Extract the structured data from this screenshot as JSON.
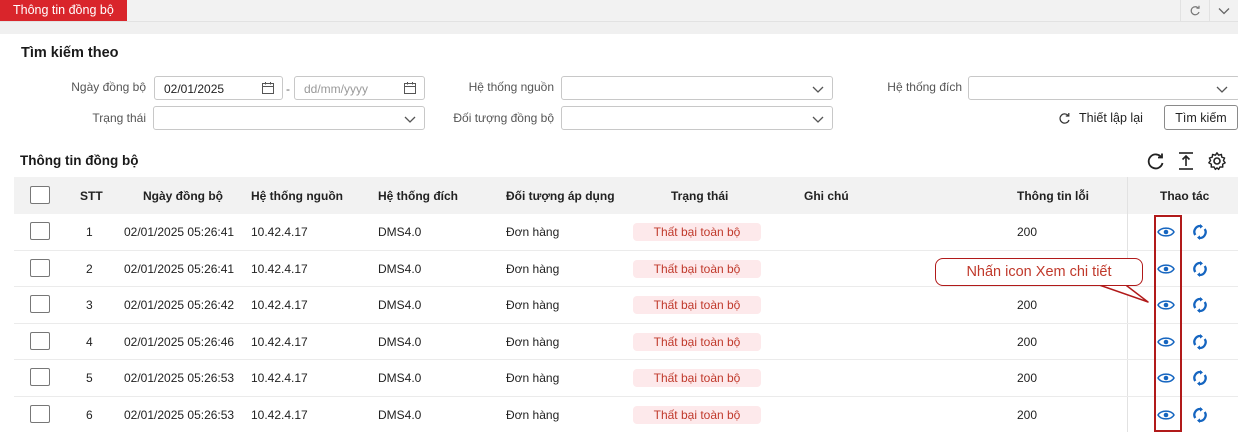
{
  "tabs": {
    "active_label": "Thông tin đồng bộ"
  },
  "search": {
    "title": "Tìm kiếm theo",
    "date_label": "Ngày đồng bộ",
    "date_from": "02/01/2025",
    "date_separator": "-",
    "date_to_placeholder": "dd/mm/yyyy",
    "source_label": "Hệ thống nguồn",
    "dest_label": "Hệ thống đích",
    "status_label": "Trạng thái",
    "object_label": "Đối tượng đồng bộ",
    "reset_label": "Thiết lập lại",
    "search_label": "Tìm kiếm"
  },
  "results": {
    "title": "Thông tin đồng bộ",
    "columns": [
      "STT",
      "Ngày đồng bộ",
      "Hệ thống nguồn",
      "Hệ thống đích",
      "Đối tượng áp dụng",
      "Trạng thái",
      "Ghi chú",
      "Thông tin lỗi",
      "Thao tác"
    ],
    "rows": [
      {
        "stt": "1",
        "date": "02/01/2025 05:26:41",
        "source": "10.42.4.17",
        "dest": "DMS4.0",
        "object": "Đơn hàng",
        "status": "Thất bại toàn bộ",
        "note": "",
        "error": "200"
      },
      {
        "stt": "2",
        "date": "02/01/2025 05:26:41",
        "source": "10.42.4.17",
        "dest": "DMS4.0",
        "object": "Đơn hàng",
        "status": "Thất bại toàn bộ",
        "note": "",
        "error": ""
      },
      {
        "stt": "3",
        "date": "02/01/2025 05:26:42",
        "source": "10.42.4.17",
        "dest": "DMS4.0",
        "object": "Đơn hàng",
        "status": "Thất bại toàn bộ",
        "note": "",
        "error": "200"
      },
      {
        "stt": "4",
        "date": "02/01/2025 05:26:46",
        "source": "10.42.4.17",
        "dest": "DMS4.0",
        "object": "Đơn hàng",
        "status": "Thất bại toàn bộ",
        "note": "",
        "error": "200"
      },
      {
        "stt": "5",
        "date": "02/01/2025 05:26:53",
        "source": "10.42.4.17",
        "dest": "DMS4.0",
        "object": "Đơn hàng",
        "status": "Thất bại toàn bộ",
        "note": "",
        "error": "200"
      },
      {
        "stt": "6",
        "date": "02/01/2025 05:26:53",
        "source": "10.42.4.17",
        "dest": "DMS4.0",
        "object": "Đơn hàng",
        "status": "Thất bại toàn bộ",
        "note": "",
        "error": "200"
      }
    ]
  },
  "annotation": {
    "callout_text": "Nhấn icon Xem chi tiết"
  },
  "colors": {
    "brand": "#d9252b",
    "status_bg": "#fde9eb",
    "status_text": "#c0392b",
    "action_blue": "#1565c0",
    "annotation": "#b11a1a"
  },
  "icons": {
    "refresh": "refresh-icon",
    "collapse": "chevron-down-icon",
    "calendar": "calendar-icon",
    "dropdown": "chevron-down-icon",
    "reset": "rotate-icon",
    "export": "upload-icon",
    "settings": "gear-icon",
    "view": "eye-icon",
    "sync": "sync-icon"
  }
}
